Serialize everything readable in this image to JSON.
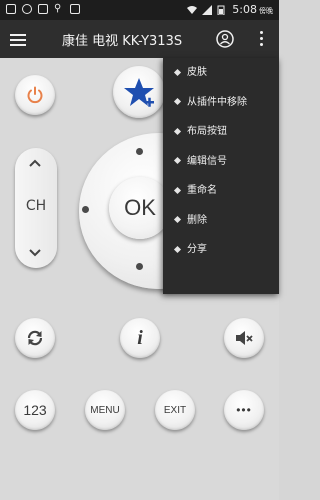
{
  "status_bar": {
    "time": "5:08",
    "time_suffix": "傍晚"
  },
  "app_bar": {
    "title": "康佳 电视 KK-Y313S"
  },
  "remote": {
    "ch_label": "CH",
    "ok_label": "OK",
    "info_label": "i",
    "num_label": "123",
    "menu_label": "MENU",
    "exit_label": "EXIT",
    "more_label": "•••"
  },
  "overflow_menu": {
    "items": [
      {
        "label": "皮肤"
      },
      {
        "label": "从插件中移除"
      },
      {
        "label": "布局按钮"
      },
      {
        "label": "编辑信号"
      },
      {
        "label": "重命名"
      },
      {
        "label": "删除"
      },
      {
        "label": "分享"
      }
    ]
  },
  "colors": {
    "power": "#e8814a",
    "star": "#1f4fb0",
    "appbar": "#2e2e2e",
    "menu": "#2b2b2b"
  }
}
